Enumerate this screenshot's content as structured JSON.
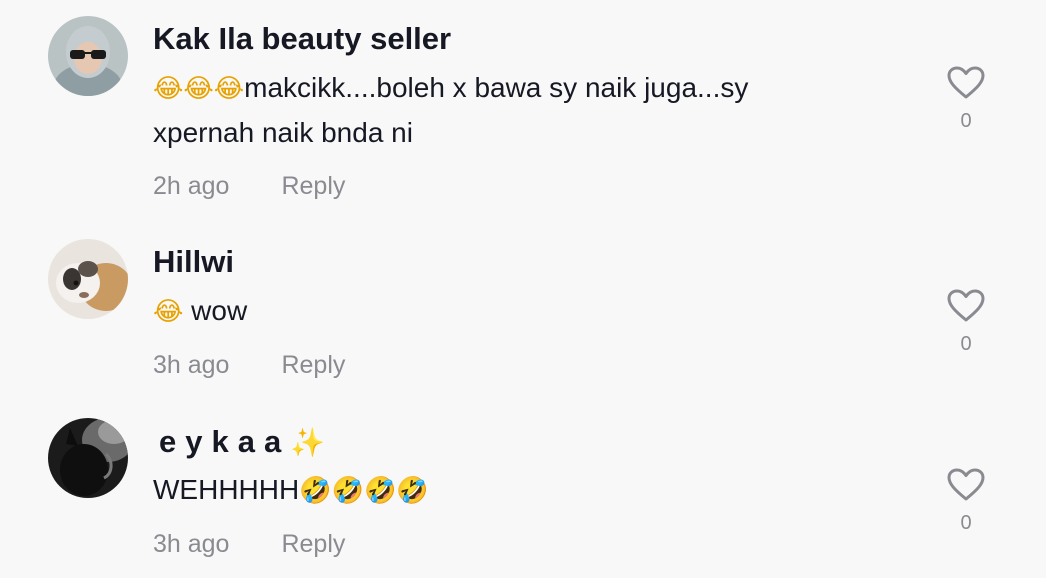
{
  "comments": [
    {
      "username": "Kak Ila beauty seller",
      "emoji_prefix": "😂😂😂",
      "text": "makcikk....boleh x bawa sy naik juga...sy xpernah naik bnda ni",
      "time": "2h ago",
      "reply_label": "Reply",
      "likes": "0"
    },
    {
      "username": "Hillwi",
      "emoji_prefix": "😂",
      "text": " wow",
      "time": "3h ago",
      "reply_label": "Reply",
      "likes": "0"
    },
    {
      "username": "eykaa",
      "username_emoji": "✨",
      "text": "WEHHHHH",
      "emoji_suffix": "🤣🤣🤣🤣",
      "time": "3h ago",
      "reply_label": "Reply",
      "likes": "0"
    }
  ],
  "icons": {
    "like": "heart-outline-icon"
  },
  "colors": {
    "background": "#f8f8f8",
    "text": "#161823",
    "secondary": "#8a8b91"
  }
}
